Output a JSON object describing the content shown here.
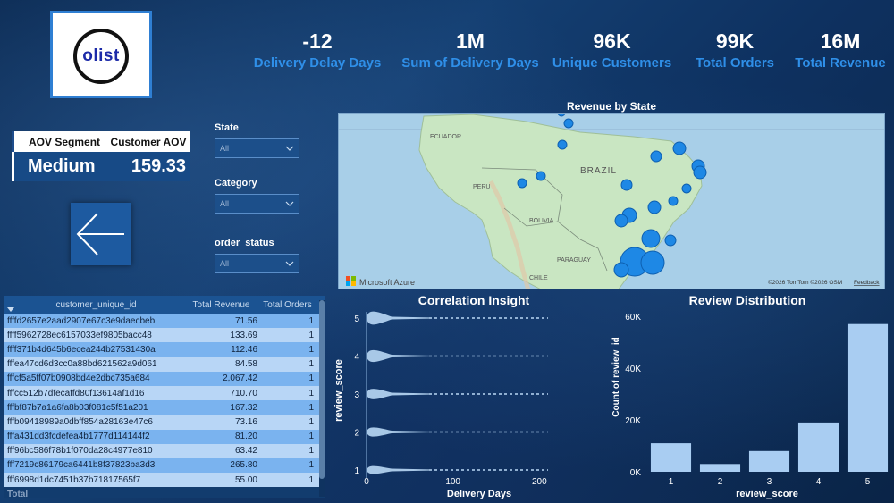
{
  "logo": {
    "text": "olist"
  },
  "kpis": [
    {
      "value": "-12",
      "label": "Delivery Delay Days"
    },
    {
      "value": "1M",
      "label": "Sum of Delivery Days"
    },
    {
      "value": "96K",
      "label": "Unique Customers"
    },
    {
      "value": "99K",
      "label": "Total Orders"
    },
    {
      "value": "16M",
      "label": "Total Revenue"
    }
  ],
  "aov": {
    "col1": "AOV Segment",
    "col2": "Customer AOV",
    "segment": "Medium",
    "value": "159.33"
  },
  "filters": [
    {
      "label": "State",
      "value": "All"
    },
    {
      "label": "Category",
      "value": "All"
    },
    {
      "label": "order_status",
      "value": "All"
    }
  ],
  "map": {
    "title": "Revenue by State",
    "labels": {
      "ecuador": "ECUADOR",
      "brazil": "BRAZIL",
      "peru": "PERU",
      "bolivia": "BOLIVIA",
      "paraguay": "PARAGUAY",
      "chile": "CHILE"
    },
    "brand": "Microsoft Azure",
    "attribution": "©2026 TomTom ©2026 OSM",
    "feedback": "Feedback",
    "bubble_color": "#1e88e5"
  },
  "table": {
    "headers": [
      "customer_unique_id",
      "Total Revenue",
      "Total Orders"
    ],
    "rows": [
      [
        "ffffd2657e2aad2907e67c3e9daecbeb",
        "71.56",
        "1"
      ],
      [
        "ffff5962728ec6157033ef9805bacc48",
        "133.69",
        "1"
      ],
      [
        "ffff371b4d645b6ecea244b27531430a",
        "112.46",
        "1"
      ],
      [
        "fffea47cd6d3cc0a88bd621562a9d061",
        "84.58",
        "1"
      ],
      [
        "fffcf5a5ff07b0908bd4e2dbc735a684",
        "2,067.42",
        "1"
      ],
      [
        "fffcc512b7dfecaffd80f13614af1d16",
        "710.70",
        "1"
      ],
      [
        "fffbf87b7a1a6fa8b03f081c5f51a201",
        "167.32",
        "1"
      ],
      [
        "fffb09418989a0dbff854a28163e47c6",
        "73.16",
        "1"
      ],
      [
        "fffa431dd3fcdefea4b1777d114144f2",
        "81.20",
        "1"
      ],
      [
        "fff96bc586f78b1f070da28c4977e810",
        "63.42",
        "1"
      ],
      [
        "fff7219c86179ca6441b8f37823ba3d3",
        "265.80",
        "1"
      ],
      [
        "fff6998d1dc7451b37b71817565f7",
        "55.00",
        "1"
      ]
    ],
    "total_label": "Total"
  },
  "chart_data": [
    {
      "type": "violin",
      "title": "Correlation Insight",
      "xlabel": "Delivery Days",
      "ylabel": "review_score",
      "x_ticks": [
        "0",
        "100",
        "200"
      ],
      "y_ticks": [
        "1",
        "2",
        "3",
        "4",
        "5"
      ],
      "xlim": [
        0,
        210
      ],
      "categories": [
        1,
        2,
        3,
        4,
        5
      ]
    },
    {
      "type": "bar",
      "title": "Review Distribution",
      "xlabel": "review_score",
      "ylabel": "Count of review_id",
      "categories": [
        "1",
        "2",
        "3",
        "4",
        "5"
      ],
      "values": [
        11000,
        3000,
        8000,
        19000,
        57000
      ],
      "ylim": [
        0,
        60000
      ],
      "y_ticks": [
        "0K",
        "20K",
        "40K",
        "60K"
      ],
      "bar_color": "#a9cdf2"
    }
  ]
}
